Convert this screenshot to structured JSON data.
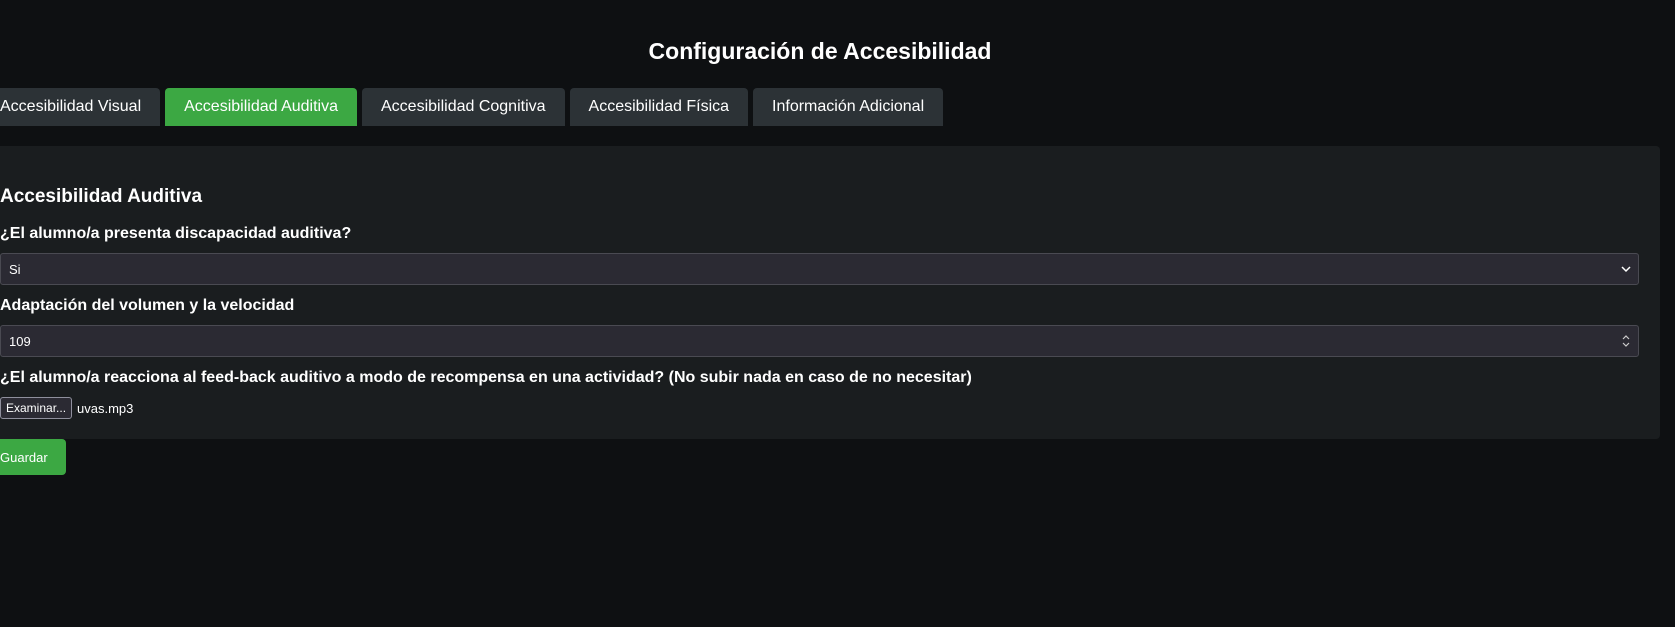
{
  "page": {
    "title": "Configuración de Accesibilidad"
  },
  "tabs": [
    {
      "label": "Accesibilidad Visual",
      "active": false
    },
    {
      "label": "Accesibilidad Auditiva",
      "active": true
    },
    {
      "label": "Accesibilidad Cognitiva",
      "active": false
    },
    {
      "label": "Accesibilidad Física",
      "active": false
    },
    {
      "label": "Información Adicional",
      "active": false
    }
  ],
  "panel": {
    "title": "Accesibilidad Auditiva",
    "hearing_question": {
      "label": "¿El alumno/a presenta discapacidad auditiva?",
      "selected": "Si",
      "icon": "chevron-down-icon"
    },
    "volume": {
      "label": "Adaptación del volumen y la velocidad",
      "value": "109",
      "icon": "spinner-icon"
    },
    "feedback": {
      "label": "¿El alumno/a reacciona al feed-back auditivo a modo de recompensa en una actividad? (No subir nada en caso de no necesitar)",
      "browse_label": "Examinar...",
      "file_name": "uvas.mp3"
    }
  },
  "actions": {
    "save_label": "Guardar"
  },
  "colors": {
    "background": "#0e1012",
    "panel": "#1a1d1f",
    "tab": "#2c3236",
    "accent": "#3ca843",
    "input": "#2b2a33"
  }
}
